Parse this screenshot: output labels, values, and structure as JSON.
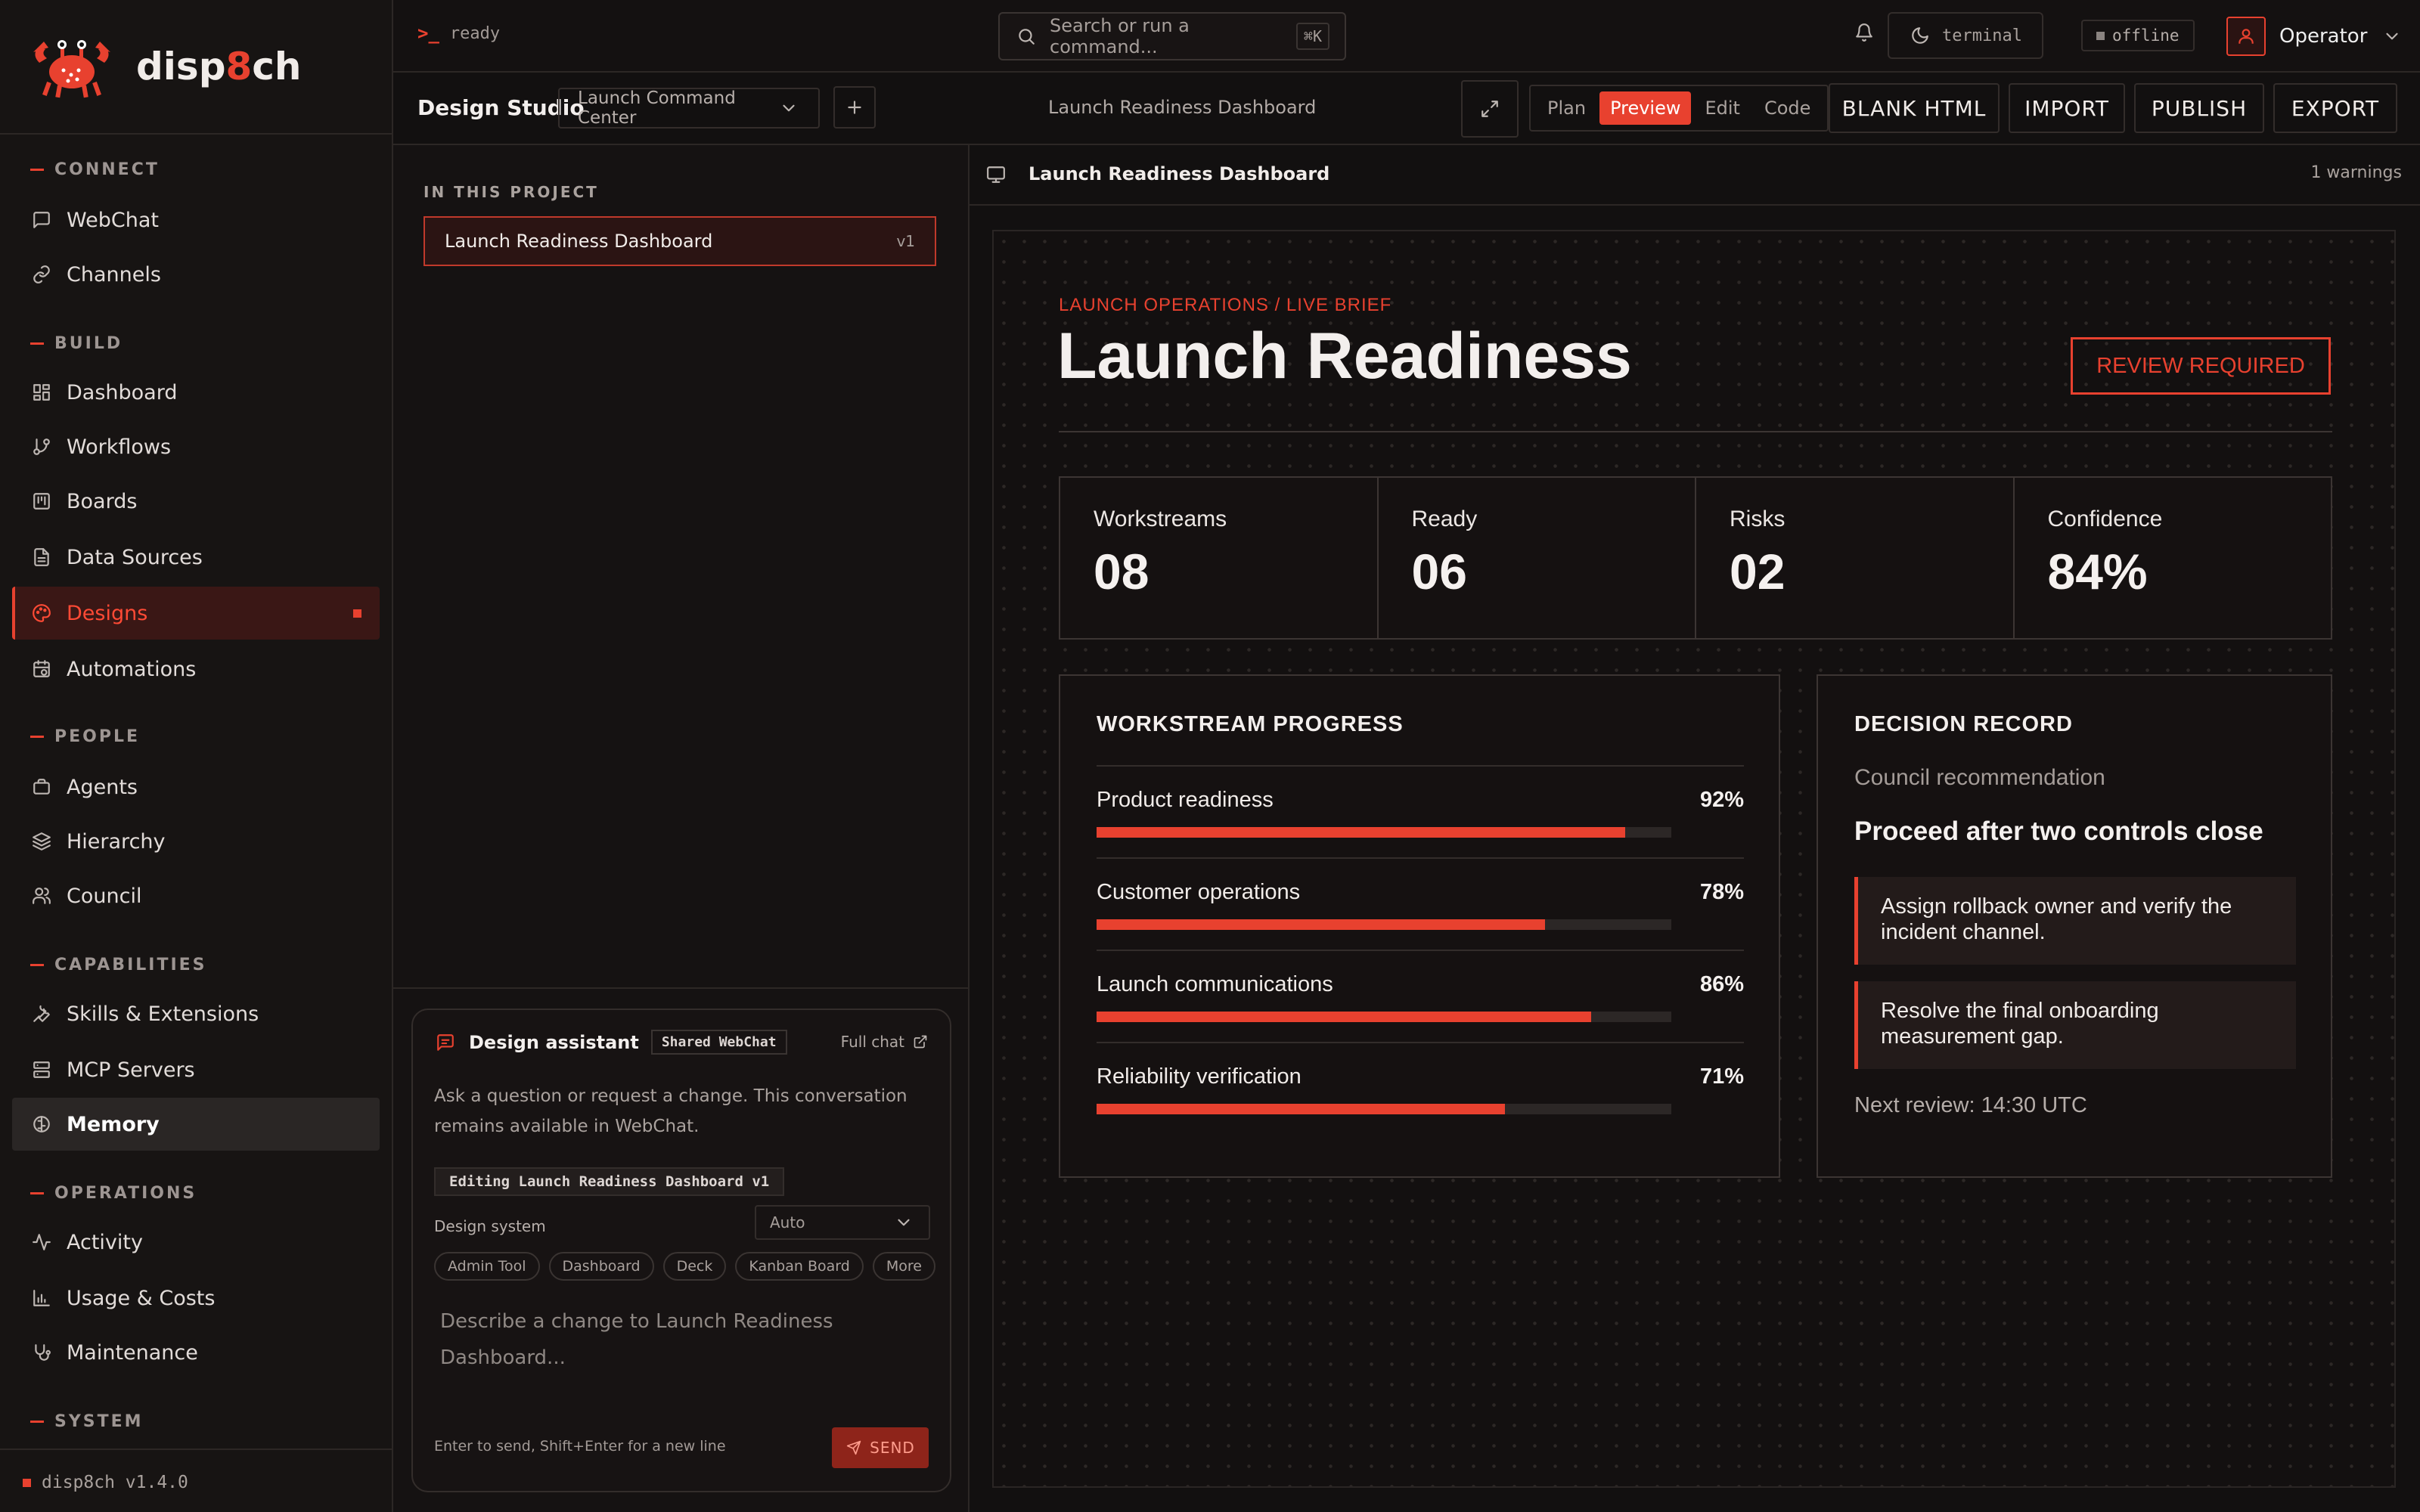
{
  "brand": {
    "prefix": "disp",
    "highlight": "8",
    "suffix": "ch"
  },
  "version": "disp8ch v1.4.0",
  "nav": {
    "sections": [
      {
        "label": "CONNECT"
      },
      {
        "label": "BUILD"
      },
      {
        "label": "PEOPLE"
      },
      {
        "label": "CAPABILITIES"
      },
      {
        "label": "OPERATIONS"
      },
      {
        "label": "SYSTEM"
      }
    ],
    "items": [
      {
        "label": "WebChat",
        "icon": "message-square-icon"
      },
      {
        "label": "Channels",
        "icon": "link-icon"
      },
      {
        "label": "Dashboard",
        "icon": "dashboard-grid-icon"
      },
      {
        "label": "Workflows",
        "icon": "git-branch-icon"
      },
      {
        "label": "Boards",
        "icon": "kanban-icon"
      },
      {
        "label": "Data Sources",
        "icon": "file-text-icon"
      },
      {
        "label": "Designs",
        "icon": "palette-icon",
        "active": true
      },
      {
        "label": "Automations",
        "icon": "calendar-clock-icon"
      },
      {
        "label": "Agents",
        "icon": "briefcase-icon"
      },
      {
        "label": "Hierarchy",
        "icon": "layers-icon"
      },
      {
        "label": "Council",
        "icon": "users-icon"
      },
      {
        "label": "Skills & Extensions",
        "icon": "wrench-icon"
      },
      {
        "label": "MCP Servers",
        "icon": "server-icon"
      },
      {
        "label": "Memory",
        "icon": "brain-icon",
        "hovered": true
      },
      {
        "label": "Activity",
        "icon": "activity-icon"
      },
      {
        "label": "Usage & Costs",
        "icon": "bar-chart-icon"
      },
      {
        "label": "Maintenance",
        "icon": "stethoscope-icon"
      }
    ]
  },
  "topbar": {
    "status": "ready",
    "search_placeholder": "Search or run a command...",
    "search_shortcut": "⌘K",
    "terminal_label": "terminal",
    "connection": "offline",
    "user": "Operator"
  },
  "studio": {
    "title": "Design Studio",
    "project": "Launch Command Center",
    "document": "Launch Readiness Dashboard",
    "modes": [
      "Plan",
      "Preview",
      "Edit",
      "Code"
    ],
    "active_mode": "Preview",
    "actions": [
      "BLANK HTML",
      "IMPORT",
      "PUBLISH",
      "EXPORT"
    ]
  },
  "files": {
    "section_label": "IN THIS PROJECT",
    "items": [
      {
        "name": "Launch Readiness Dashboard",
        "version": "v1"
      }
    ]
  },
  "assistant": {
    "title": "Design assistant",
    "badge": "Shared WebChat",
    "full_chat": "Full chat",
    "description": "Ask a question or request a change. This conversation remains available in WebChat.",
    "editing": "Editing Launch Readiness Dashboard v1",
    "design_system_label": "Design system",
    "design_system_value": "Auto",
    "templates": [
      "Admin Tool",
      "Dashboard",
      "Deck",
      "Kanban Board",
      "More"
    ],
    "input_placeholder": "Describe a change to Launch Readiness Dashboard...",
    "hint": "Enter to send, Shift+Enter for a new line",
    "send_label": "SEND"
  },
  "preview": {
    "title": "Launch Readiness Dashboard",
    "warnings": "1 warnings",
    "eyebrow": "LAUNCH OPERATIONS / LIVE BRIEF",
    "heading": "Launch Readiness",
    "badge": "REVIEW REQUIRED",
    "stats": [
      {
        "label": "Workstreams",
        "value": "08"
      },
      {
        "label": "Ready",
        "value": "06"
      },
      {
        "label": "Risks",
        "value": "02"
      },
      {
        "label": "Confidence",
        "value": "84%"
      }
    ],
    "progress_title": "WORKSTREAM PROGRESS",
    "progress": [
      {
        "name": "Product readiness",
        "pct_label": "92%",
        "pct": 92
      },
      {
        "name": "Customer operations",
        "pct_label": "78%",
        "pct": 78
      },
      {
        "name": "Launch communications",
        "pct_label": "86%",
        "pct": 86
      },
      {
        "name": "Reliability verification",
        "pct_label": "71%",
        "pct": 71
      }
    ],
    "decision": {
      "title": "DECISION RECORD",
      "subtitle": "Council recommendation",
      "recommendation": "Proceed after two controls close",
      "controls": [
        "Assign rollback owner and verify the incident channel.",
        "Resolve the final onboarding measurement gap."
      ],
      "next_review": "Next review: 14:30 UTC"
    }
  },
  "colors": {
    "accent": "#e8412f",
    "background": "#121010",
    "panel": "#171413",
    "border": "#2c2725"
  }
}
